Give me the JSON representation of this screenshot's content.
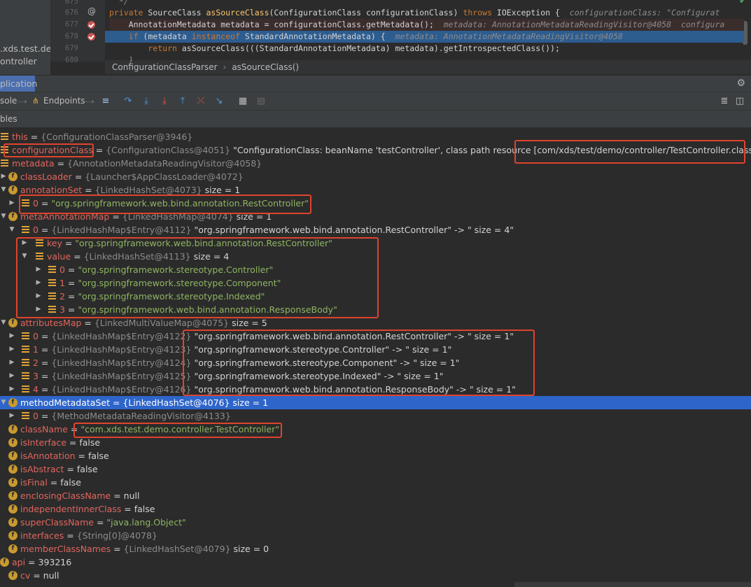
{
  "project": {
    "lines": [
      ".xds.test.de",
      "ontroller"
    ]
  },
  "editor": {
    "lines": [
      {
        "num": "675",
        "code": "  */"
      },
      {
        "num": "676",
        "code_parts": [
          {
            "t": "private ",
            "c": "kw"
          },
          {
            "t": "SourceClass ",
            "c": "plain"
          },
          {
            "t": "asSourceClass",
            "c": "fn"
          },
          {
            "t": "(ConfigurationClass configurationClass) ",
            "c": "plain"
          },
          {
            "t": "throws ",
            "c": "kw"
          },
          {
            "t": "IOException {  ",
            "c": "plain"
          },
          {
            "t": "configurationClass: \"Configurat",
            "c": "hint"
          }
        ]
      },
      {
        "num": "677",
        "code_parts": [
          {
            "t": "    AnnotationMetadata metadata = configurationClass.getMetadata();  ",
            "c": "plain"
          },
          {
            "t": "metadata: AnnotationMetadataReadingVisitor@4058  configura",
            "c": "hint"
          }
        ]
      },
      {
        "num": "678",
        "code_parts": [
          {
            "t": "    if ",
            "c": "kw"
          },
          {
            "t": "(metadata ",
            "c": "plain"
          },
          {
            "t": "instanceof ",
            "c": "kw"
          },
          {
            "t": "StandardAnnotationMetadata) {  ",
            "c": "plain"
          },
          {
            "t": "metadata: AnnotationMetadataReadingVisitor@4058",
            "c": "hint"
          }
        ]
      },
      {
        "num": "679",
        "code_parts": [
          {
            "t": "        return ",
            "c": "kw"
          },
          {
            "t": "asSourceClass(((StandardAnnotationMetadata) metadata).getIntrospectedClass());",
            "c": "plain"
          }
        ]
      },
      {
        "num": "680",
        "code": "    }"
      }
    ],
    "breadcrumb": [
      "ConfigurationClassParser",
      "asSourceClass()"
    ]
  },
  "debug": {
    "tab_label": "plication",
    "toolbar": {
      "console_label": "sole",
      "endpoints_label": "Endpoints"
    },
    "vars_title": "bles"
  },
  "tree": [
    {
      "depth": 0,
      "expand": "",
      "icon": "list",
      "name": "this",
      "eq": " = ",
      "type": "{ConfigurationClassParser@3946}",
      "rest": ""
    },
    {
      "depth": 0,
      "expand": "",
      "icon": "list",
      "name": "configurationClass",
      "eq": " = ",
      "type": "{ConfigurationClass@4051}",
      "rest": " \"ConfigurationClass: beanName 'testController', class path resource [com/xds/test/demo/controller/TestController.class]\""
    },
    {
      "depth": 0,
      "expand": "",
      "icon": "list",
      "name": "metadata",
      "eq": " = ",
      "type": "{AnnotationMetadataReadingVisitor@4058}",
      "rest": ""
    },
    {
      "depth": 1,
      "expand": "closed",
      "icon": "f",
      "name": "classLoader",
      "eq": " = ",
      "type": "{Launcher$AppClassLoader@4072}",
      "rest": ""
    },
    {
      "depth": 1,
      "expand": "open",
      "icon": "f",
      "name": "annotationSet",
      "eq": " = ",
      "type": "{LinkedHashSet@4073}",
      "rest": "  size = 1"
    },
    {
      "depth": 2,
      "expand": "closed",
      "icon": "list",
      "name": "0",
      "eq": " = ",
      "str": "\"org.springframework.web.bind.annotation.RestController\"",
      "rest": ""
    },
    {
      "depth": 1,
      "expand": "open",
      "icon": "f",
      "name": "metaAnnotationMap",
      "eq": " = ",
      "type": "{LinkedHashMap@4074}",
      "rest": "  size = 1"
    },
    {
      "depth": 2,
      "expand": "open",
      "icon": "list",
      "name": "0",
      "eq": " = ",
      "type": "{LinkedHashMap$Entry@4112}",
      "rest": " \"org.springframework.web.bind.annotation.RestController\" -> \" size = 4\""
    },
    {
      "depth": 3,
      "expand": "closed",
      "icon": "list",
      "name": "key",
      "eq": " = ",
      "str": "\"org.springframework.web.bind.annotation.RestController\"",
      "rest": ""
    },
    {
      "depth": 3,
      "expand": "open",
      "icon": "list",
      "name": "value",
      "eq": " = ",
      "type": "{LinkedHashSet@4113}",
      "rest": "  size = 4"
    },
    {
      "depth": 4,
      "expand": "closed",
      "icon": "list",
      "name": "0",
      "eq": " = ",
      "str": "\"org.springframework.stereotype.Controller\"",
      "rest": ""
    },
    {
      "depth": 4,
      "expand": "closed",
      "icon": "list",
      "name": "1",
      "eq": " = ",
      "str": "\"org.springframework.stereotype.Component\"",
      "rest": ""
    },
    {
      "depth": 4,
      "expand": "closed",
      "icon": "list",
      "name": "2",
      "eq": " = ",
      "str": "\"org.springframework.stereotype.Indexed\"",
      "rest": ""
    },
    {
      "depth": 4,
      "expand": "closed",
      "icon": "list",
      "name": "3",
      "eq": " = ",
      "str": "\"org.springframework.web.bind.annotation.ResponseBody\"",
      "rest": ""
    },
    {
      "depth": 1,
      "expand": "open",
      "icon": "f",
      "name": "attributesMap",
      "eq": " = ",
      "type": "{LinkedMultiValueMap@4075}",
      "rest": "  size = 5"
    },
    {
      "depth": 2,
      "expand": "closed",
      "icon": "list",
      "name": "0",
      "eq": " = ",
      "type": "{LinkedHashMap$Entry@4122}",
      "rest": " \"org.springframework.web.bind.annotation.RestController\" -> \" size = 1\""
    },
    {
      "depth": 2,
      "expand": "closed",
      "icon": "list",
      "name": "1",
      "eq": " = ",
      "type": "{LinkedHashMap$Entry@4123}",
      "rest": " \"org.springframework.stereotype.Controller\" -> \" size = 1\""
    },
    {
      "depth": 2,
      "expand": "closed",
      "icon": "list",
      "name": "2",
      "eq": " = ",
      "type": "{LinkedHashMap$Entry@4124}",
      "rest": " \"org.springframework.stereotype.Component\" -> \" size = 1\""
    },
    {
      "depth": 2,
      "expand": "closed",
      "icon": "list",
      "name": "3",
      "eq": " = ",
      "type": "{LinkedHashMap$Entry@4125}",
      "rest": " \"org.springframework.stereotype.Indexed\" -> \" size = 1\""
    },
    {
      "depth": 2,
      "expand": "closed",
      "icon": "list",
      "name": "4",
      "eq": " = ",
      "type": "{LinkedHashMap$Entry@4126}",
      "rest": " \"org.springframework.web.bind.annotation.ResponseBody\" -> \" size = 1\""
    },
    {
      "depth": 1,
      "expand": "open",
      "icon": "f",
      "name": "methodMetadataSet",
      "eq": " = ",
      "type": "{LinkedHashSet@4076}",
      "rest": "  size = 1",
      "selected": true
    },
    {
      "depth": 2,
      "expand": "closed",
      "icon": "list",
      "name": "0",
      "eq": " = ",
      "type": "{MethodMetadataReadingVisitor@4133}",
      "rest": ""
    },
    {
      "depth": 1,
      "expand": "",
      "icon": "f",
      "name": "className",
      "eq": " = ",
      "str": "\"com.xds.test.demo.controller.TestController\"",
      "rest": ""
    },
    {
      "depth": 1,
      "expand": "",
      "icon": "f",
      "name": "isInterface",
      "eq": " = ",
      "rest": "false"
    },
    {
      "depth": 1,
      "expand": "",
      "icon": "f",
      "name": "isAnnotation",
      "eq": " = ",
      "rest": "false"
    },
    {
      "depth": 1,
      "expand": "",
      "icon": "f",
      "name": "isAbstract",
      "eq": " = ",
      "rest": "false"
    },
    {
      "depth": 1,
      "expand": "",
      "icon": "f",
      "name": "isFinal",
      "eq": " = ",
      "rest": "false"
    },
    {
      "depth": 1,
      "expand": "",
      "icon": "f",
      "name": "enclosingClassName",
      "eq": " = ",
      "rest": "null"
    },
    {
      "depth": 1,
      "expand": "",
      "icon": "f",
      "name": "independentInnerClass",
      "eq": " = ",
      "rest": "false"
    },
    {
      "depth": 1,
      "expand": "",
      "icon": "f",
      "name": "superClassName",
      "eq": " = ",
      "str": "\"java.lang.Object\"",
      "rest": ""
    },
    {
      "depth": 1,
      "expand": "",
      "icon": "f",
      "name": "interfaces",
      "eq": " = ",
      "type": "{String[0]@4078}",
      "rest": ""
    },
    {
      "depth": 1,
      "expand": "",
      "icon": "f",
      "name": "memberClassNames",
      "eq": " = ",
      "type": "{LinkedHashSet@4079}",
      "rest": "  size = 0"
    },
    {
      "depth": 0,
      "expand": "",
      "icon": "f",
      "name": "api",
      "eq": " = ",
      "rest": "393216"
    },
    {
      "depth": 1,
      "expand": "",
      "icon": "f",
      "name": "cv",
      "eq": " = ",
      "rest": "null"
    }
  ],
  "colors": {
    "highlight_box": "#e0432e",
    "selection": "#2e65ca",
    "variable_name": "#e0665f",
    "string_value": "#8fb561"
  }
}
